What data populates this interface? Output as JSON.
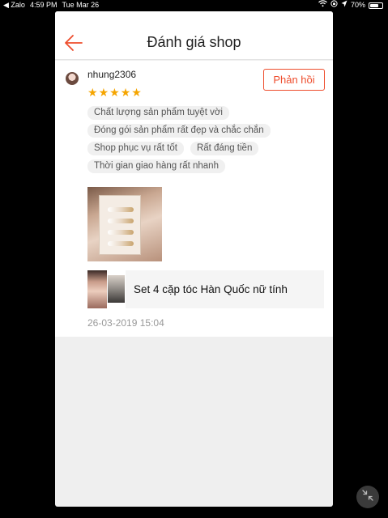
{
  "status_bar": {
    "back_app": "◀ Zalo",
    "time": "4:59 PM",
    "date": "Tue Mar 26",
    "battery": "70%",
    "battery_level": 0.7
  },
  "header": {
    "title": "Đánh giá shop",
    "back_icon": "arrow-left-icon"
  },
  "review": {
    "username": "nhung2306",
    "rating": 5,
    "reply_label": "Phản hồi",
    "tags": [
      "Chất lượng sản phẩm tuyệt vời",
      "Đóng gói sản phẩm rất đẹp và chắc chắn",
      "Shop phục vụ rất tốt",
      "Rất đáng tiền",
      "Thời gian giao hàng rất nhanh"
    ],
    "product_name": "Set 4 cặp tóc Hàn Quốc nữ tính",
    "timestamp": "26-03-2019 15:04"
  },
  "colors": {
    "accent": "#ee4d2d",
    "star": "#f5a500"
  }
}
